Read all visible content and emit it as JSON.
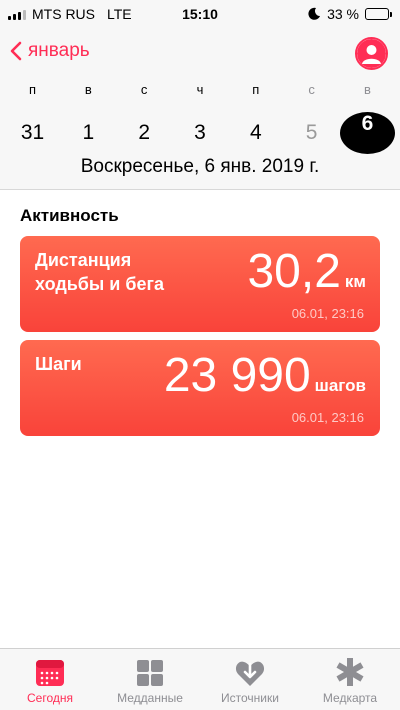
{
  "status_bar": {
    "carrier": "MTS RUS",
    "network": "LTE",
    "time": "15:10",
    "battery_percent": "33 %",
    "battery_level": 0.33
  },
  "header": {
    "month": "январь",
    "weekdays": [
      "п",
      "в",
      "с",
      "ч",
      "п",
      "с",
      "в"
    ],
    "days": [
      "31",
      "1",
      "2",
      "3",
      "4",
      "5",
      "6"
    ],
    "selected_day": "6",
    "date_caption": "Воскресенье, 6 янв. 2019 г."
  },
  "content": {
    "section_title": "Активность",
    "cards": [
      {
        "label": "Дистанция ходьбы и бега",
        "value": "30,2",
        "unit": "км",
        "time": "06.01, 23:16"
      },
      {
        "label": "Шаги",
        "value": "23 990",
        "unit": "шагов",
        "time": "06.01, 23:16"
      }
    ]
  },
  "tabs": [
    {
      "label": "Сегодня",
      "icon": "today-icon",
      "active": true
    },
    {
      "label": "Медданные",
      "icon": "grid-icon",
      "active": false
    },
    {
      "label": "Источники",
      "icon": "heart-arrow-icon",
      "active": false
    },
    {
      "label": "Медкарта",
      "icon": "asterisk-icon",
      "active": false
    }
  ],
  "colors": {
    "accent": "#ff2d55",
    "card": "#f9433a",
    "inactive": "#8e8e93"
  }
}
